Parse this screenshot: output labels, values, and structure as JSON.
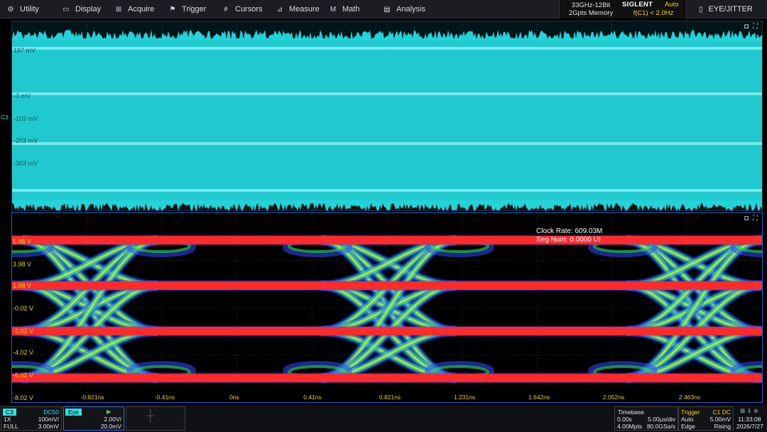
{
  "menu": {
    "items": [
      {
        "label": "Utility",
        "icon": "gear-icon"
      },
      {
        "label": "Display",
        "icon": "monitor-icon"
      },
      {
        "label": "Acquire",
        "icon": "acquire-icon"
      },
      {
        "label": "Trigger",
        "icon": "flag-icon"
      },
      {
        "label": "Cursors",
        "icon": "cursor-grid-icon"
      },
      {
        "label": "Measure",
        "icon": "measure-icon"
      },
      {
        "label": "Math",
        "icon": "math-icon"
      },
      {
        "label": "Analysis",
        "icon": "analysis-icon"
      }
    ]
  },
  "header": {
    "bandwidth": "33GHz-12Bit",
    "memory": "2Gpts Memory",
    "brand": "SIGLENT",
    "trigger_mode": "Auto",
    "frequency": "f(C1) < 2.0Hz",
    "eye_jitter": "EYE/JITTER"
  },
  "waveform": {
    "channel_marker": "C3",
    "y_labels": [
      "197 mV",
      "-3 mV",
      "-103 mV",
      "-203 mV",
      "-303 mV"
    ],
    "color": "#22d3d8"
  },
  "eye": {
    "clock_rate": "Clock Rate: 609.03M",
    "seg_num": "Seg Num: 0.0000 UI",
    "y_labels": [
      "5.98 V",
      "3.98 V",
      "1.98 V",
      "-0.02 V",
      "-2.02 V",
      "-4.02 V",
      "-6.02 V",
      "-8.02 V"
    ],
    "x_labels": [
      "-0.821ns",
      "-0.41ns",
      "0ns",
      "0.41ns",
      "0.821ns",
      "1.231ns",
      "1.642ns",
      "2.052ns",
      "2.463ns"
    ],
    "level_color": "#ff2a2a"
  },
  "status": {
    "ch3": {
      "name": "C3",
      "coupling": "DC50",
      "probe": "1X",
      "scale": "100mV/",
      "bw": "FULL",
      "offset": "3.00mV"
    },
    "eye": {
      "name": "Eye",
      "scale": "2.00V/",
      "offset": "20.0mV"
    },
    "timebase": {
      "title": "Timebase",
      "delay": "0.00s",
      "scale": "5.00µs/div",
      "points": "4.00Mpts",
      "rate": "80.0GSa/s"
    },
    "trigger": {
      "title": "Trigger",
      "source": "C1 DC",
      "mode": "Auto",
      "level": "5.00mV",
      "type": "Edge",
      "slope": "Rising"
    },
    "clock": {
      "time": "11:33:08",
      "date": "2026/7/27"
    }
  }
}
